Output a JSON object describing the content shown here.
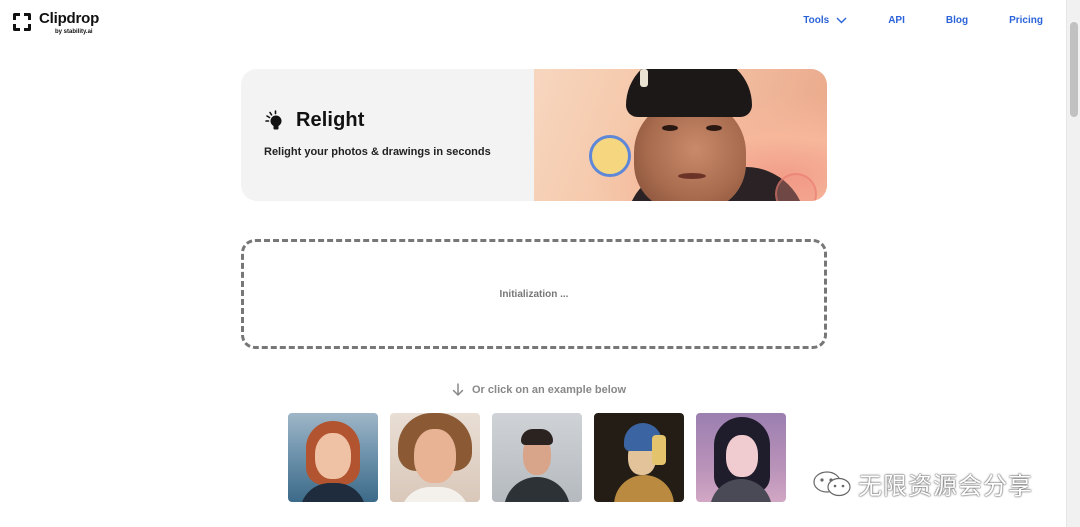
{
  "header": {
    "logo_name": "Clipdrop",
    "logo_sub": "by stability.ai",
    "nav": [
      {
        "label": "Tools",
        "has_dropdown": true
      },
      {
        "label": "API"
      },
      {
        "label": "Blog"
      },
      {
        "label": "Pricing"
      }
    ],
    "link_color": "#2b63d9"
  },
  "hero": {
    "icon": "lightbulb-icon",
    "title": "Relight",
    "subtitle": "Relight your photos & drawings in seconds"
  },
  "dropzone": {
    "status": "Initialization ..."
  },
  "examples": {
    "label": "Or click on an example below",
    "items": [
      {
        "name": "example-1"
      },
      {
        "name": "example-2"
      },
      {
        "name": "example-3"
      },
      {
        "name": "example-4"
      },
      {
        "name": "example-5"
      }
    ]
  },
  "watermark": {
    "text": "无限资源会分享"
  }
}
